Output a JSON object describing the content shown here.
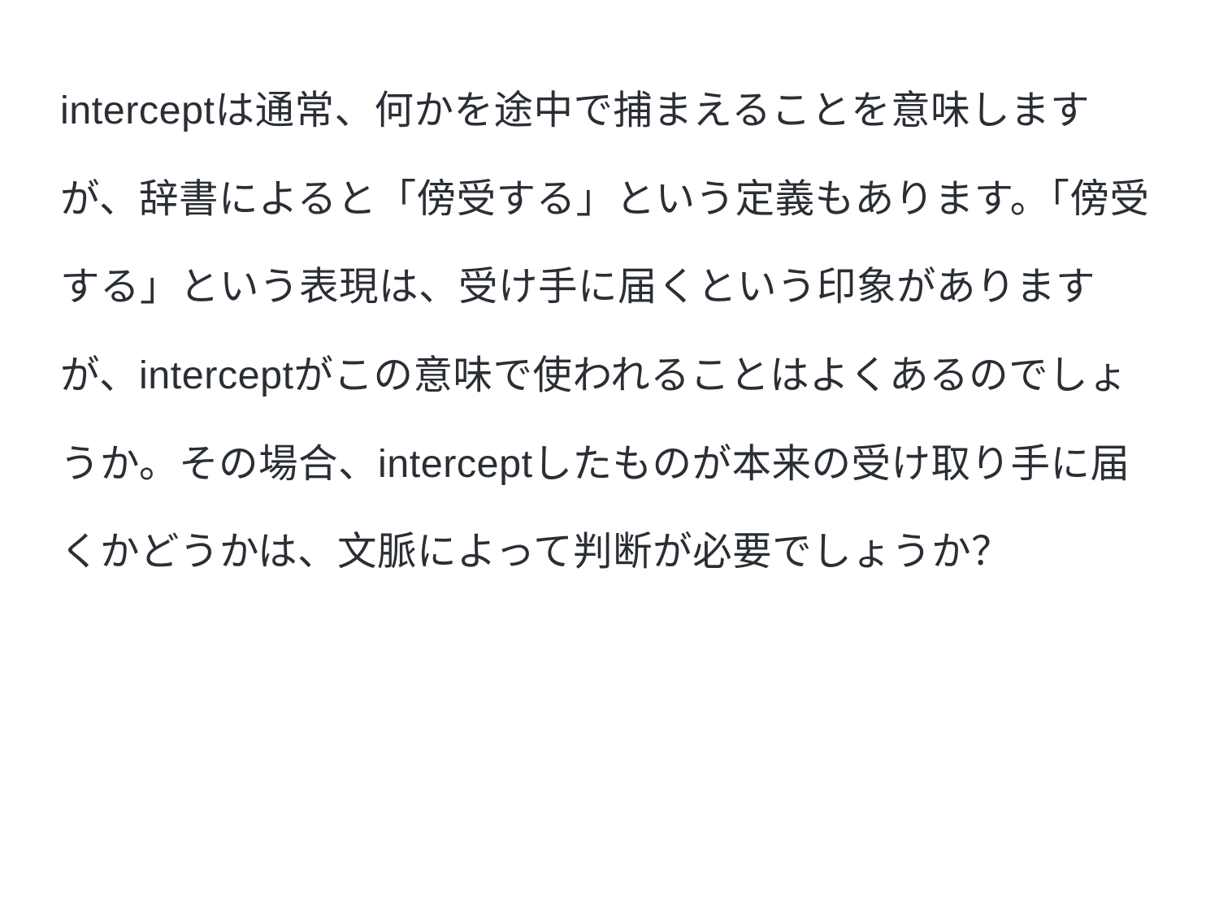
{
  "document": {
    "paragraph": "interceptは通常、何かを途中で捕まえることを意味しますが、辞書によると「傍受する」という定義もあります。「傍受する」という表現は、受け手に届くという印象がありますが、interceptがこの意味で使われることはよくあるのでしょうか。その場合、interceptしたものが本来の受け取り手に届くかどうかは、文脈によって判断が必要でしょうか？"
  }
}
